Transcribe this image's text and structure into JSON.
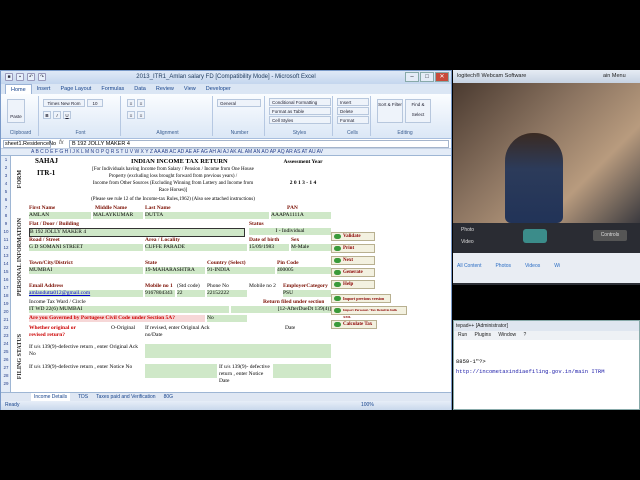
{
  "excel": {
    "title": "2013_ITR1_Amlan salary FD [Compatibility Mode] - Microsoft Excel",
    "tabs": [
      "Home",
      "Insert",
      "Page Layout",
      "Formulas",
      "Data",
      "Review",
      "View",
      "Developer"
    ],
    "font_name": "Times New Rom",
    "font_size": "10",
    "ribbon_groups": [
      "Clipboard",
      "Font",
      "Alignment",
      "Number",
      "Styles",
      "Cells",
      "Editing"
    ],
    "ribbon_items": {
      "general": "General",
      "cond_format": "Conditional Formatting",
      "format_table": "Format as Table",
      "cell_styles": "Cell Styles",
      "insert": "Insert",
      "delete": "Delete",
      "format": "Format",
      "sort": "Sort & Filter",
      "find": "Find & Select",
      "paste": "Paste"
    },
    "name_box": "sheet1.ResidenceNo",
    "formula": "B 192 JOLLY MAKER 4",
    "col_header": "A  B  C  D  E F G H I J K L M N O P Q R S T U V  W X Y Z AA AB AC AD AE AF AG AH AI AJ AK AL AM  AN  AO AP AQ AR AS AT AU  AV",
    "form": {
      "sahaj": "SAHAJ",
      "itr": "ITR-1",
      "form_side": "FORM",
      "title": "INDIAN INCOME TAX RETURN",
      "sub1": "[For Individuals having Income from Salary / Pension / Income from One House",
      "sub2": "Property (excluding loss brought forward from previous years) /",
      "sub3": "Income from Other Sources (Excluding Winning from Lottery and Income from",
      "sub4": "Race Horses)]",
      "sub5": "(Please see rule 12 of the Income-tax Rules,1962) (Also see attached instructions)",
      "ay_label": "Assessment Year",
      "ay": "2 0 1 3 - 1 4",
      "first_name": "First Name",
      "middle_name": "Middle Name",
      "last_name": "Last Name",
      "pan_label": "PAN",
      "first_val": "AMLAN",
      "middle_val": "MALAYKUMAR",
      "last_val": "DUTTA",
      "pan_val": "AAAPA1111A",
      "flat_label": "Flat / Door / Building",
      "flat_val": "B 192 JOLLY MAKER 4",
      "status_label": "Status",
      "status_val": "I - Individual",
      "road_label": "Road / Street",
      "road_val": "G D SOMANI STREET",
      "area_label": "Area / Locality",
      "area_val": "CUFFE PARADE",
      "dob_label": "Date of birth",
      "dob_val": "15/09/1983",
      "sex_label": "Sex",
      "sex_val": "M-Male",
      "town_label": "Town/City/District",
      "town_val": "MUMBAI",
      "state_label": "State",
      "state_val": "19-MAHARASHTRA",
      "country_label": "Country (Select)",
      "country_val": "91-INDIA",
      "pin_label": "Pin Code",
      "pin_val": "400005",
      "email_label": "Email Address",
      "email_val": "amlandutta012@gmail.com",
      "mobile_label": "Mobile no 1",
      "mobile_val": "9167804343",
      "std_label": "(Std code)",
      "std_val": "22",
      "phone_label": "Phone No",
      "phone_val": "22152222",
      "mobile2_label": "Mobile no 2",
      "emp_label": "EmployerCategory",
      "emp_val": "PSU",
      "ward_label": "Income Tax Ward / Circle",
      "ward_val": "IT WD 22(6) MUMBAI",
      "filed_label": "Return filed under section",
      "filed_val": "[12-AfterDueDt 139(4)]",
      "portugese": "Are you Governed by Portugese Civil Code under Section 5A?",
      "portugese_val": "No",
      "whether": "Whether original or revised return?",
      "original": "O-Original",
      "if_revised": "If revised, enter Original Ack no/Date",
      "date_label": "Date",
      "defective1": "If u/s 139(9)-defective return , enter Original Ack No",
      "defective2": "If u/s 139(9)-defective return , enter Notice No",
      "defective3": "If u/s 139(9)- defective return , enter Notice Date",
      "personal_side": "PERSONAL INFORMATION",
      "filing_side": "FILING STATUS"
    },
    "macros": [
      "Validate",
      "Print",
      "Next",
      "Generate",
      "Help",
      "Import previous version",
      "Import Personal / Tax Detail in bulk XML",
      "Calculate Tax"
    ],
    "sheet_tabs": [
      "Income Details",
      "TDS",
      "Taxes paid and Verification",
      "80G"
    ],
    "status": "Ready",
    "zoom": "100%"
  },
  "webcam": {
    "title": "logitech® Webcam Software",
    "title_right": "ain Menu",
    "photo": "Photo",
    "video": "Video",
    "controls": "Controls",
    "tabs": [
      "All Content",
      "Photos",
      "Videos",
      "Wi"
    ]
  },
  "notepad": {
    "title": "tepad++ [Administrator]",
    "menu": "Run Plugins Window ?",
    "line1": "8859-1\"?>",
    "line2": "http://incometaxindiaefiling.gov.in/main ITRM"
  }
}
